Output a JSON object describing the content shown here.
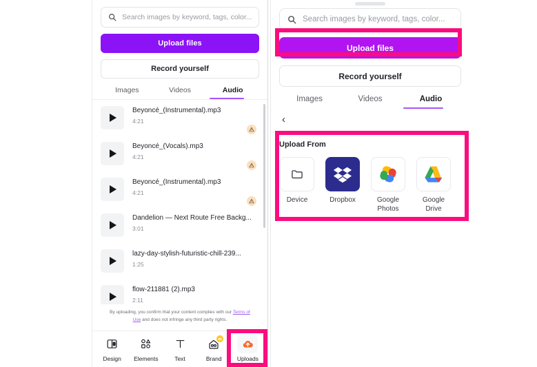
{
  "left_panel": {
    "search": {
      "placeholder": "Search images by keyword, tags, color...",
      "icon": "search-icon"
    },
    "upload_button": "Upload files",
    "record_button": "Record yourself",
    "tabs": [
      {
        "label": "Images",
        "active": false
      },
      {
        "label": "Videos",
        "active": false
      },
      {
        "label": "Audio",
        "active": true
      }
    ],
    "audio_items": [
      {
        "title": "Beyoncé_(Instrumental).mp3",
        "duration": "4:21",
        "warning": true
      },
      {
        "title": "Beyoncé_(Vocals).mp3",
        "duration": "4:21",
        "warning": true
      },
      {
        "title": "Beyoncé_(Instrumental).mp3",
        "duration": "4:21",
        "warning": true
      },
      {
        "title": "Dandelion — Next Route Free Backg...",
        "duration": "3:01",
        "warning": false
      },
      {
        "title": "lazy-day-stylish-futuristic-chill-239...",
        "duration": "1:25",
        "warning": false
      },
      {
        "title": "flow-211881 (2).mp3",
        "duration": "2:11",
        "warning": false
      }
    ],
    "legal": {
      "part1": "By uploading, you confirm that your content complies with our ",
      "link": "Terms of Use",
      "part2": " and does not infringe any third party rights."
    },
    "bottom_nav": [
      {
        "label": "Design",
        "icon": "design-icon",
        "active": false
      },
      {
        "label": "Elements",
        "icon": "elements-icon",
        "active": false
      },
      {
        "label": "Text",
        "icon": "text-icon",
        "active": false
      },
      {
        "label": "Brand",
        "icon": "brand-icon",
        "active": false,
        "badge": "crown-badge"
      },
      {
        "label": "Uploads",
        "icon": "uploads-cloud-icon",
        "active": true
      }
    ]
  },
  "right_panel": {
    "search": {
      "placeholder": "Search images by keyword, tags, color...",
      "icon": "search-icon"
    },
    "upload_button": "Upload files",
    "record_button": "Record yourself",
    "tabs": [
      {
        "label": "Images",
        "active": false
      },
      {
        "label": "Videos",
        "active": false
      },
      {
        "label": "Audio",
        "active": true
      }
    ],
    "back_chevron": "‹",
    "upload_from": {
      "title": "Upload From",
      "sources": [
        {
          "label": "Device",
          "icon": "folder-icon"
        },
        {
          "label": "Dropbox",
          "icon": "dropbox-icon"
        },
        {
          "label": "Google Photos",
          "icon": "google-photos-icon"
        },
        {
          "label": "Google Drive",
          "icon": "google-drive-icon"
        }
      ]
    }
  },
  "colors": {
    "highlight": "#fb0c7f",
    "brand_purple_left": "#8b13f5",
    "brand_purple_right": "#b114f0",
    "tab_underline": "#a855f7",
    "warning_badge": "#fae0bf",
    "uploads_orange": "#f9692c"
  }
}
